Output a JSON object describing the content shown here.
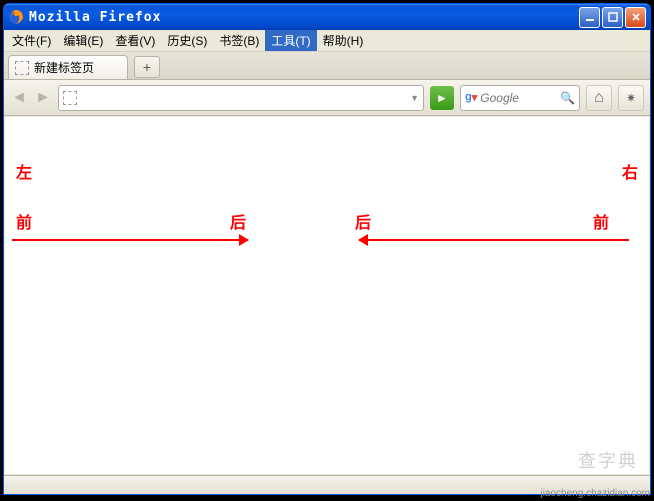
{
  "titlebar": {
    "title": "Mozilla Firefox"
  },
  "menu": {
    "file": "文件(F)",
    "edit": "编辑(E)",
    "view": "查看(V)",
    "history": "历史(S)",
    "bookmarks": "书签(B)",
    "tools": "工具(T)",
    "help": "帮助(H)"
  },
  "tabs": {
    "tab1": "新建标签页",
    "newtab": "+"
  },
  "nav": {
    "back": "◄",
    "fwd": "►",
    "go": "►",
    "search_placeholder": "Google",
    "magnify": "🔍",
    "home": "⌂",
    "addon": "✷"
  },
  "content": {
    "left": "左",
    "right": "右",
    "front1": "前",
    "back1": "后",
    "back2": "后",
    "front2": "前"
  },
  "watermark": {
    "big": "查字典",
    "small": "jiaocheng.chazidian.com"
  }
}
